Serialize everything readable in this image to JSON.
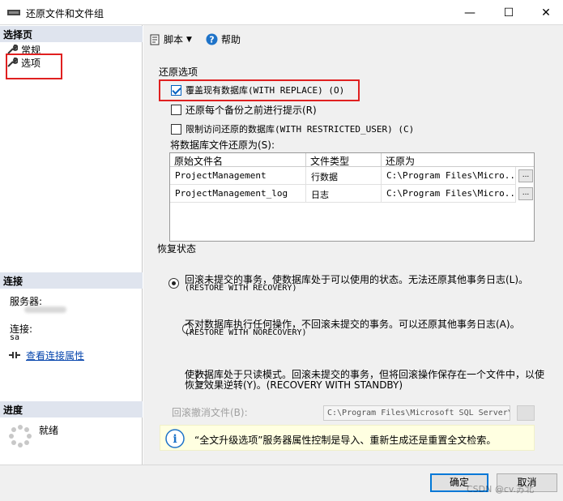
{
  "window": {
    "title": "还原文件和文件组",
    "minimize": "—",
    "maximize": "☐",
    "close": "✕"
  },
  "left": {
    "select_page_header": "选择页",
    "nav_items": [
      "常规",
      "选项"
    ],
    "connection_header": "连接",
    "server_label": "服务器:",
    "connection_label": "连接:",
    "connection_user": "sa",
    "view_conn_props": "查看连接属性",
    "progress_header": "进度",
    "progress_status": "就绪"
  },
  "toolbar": {
    "script_label": "脚本",
    "help_label": "帮助"
  },
  "restore_options": {
    "group_label": "还原选项",
    "overwrite": "覆盖现有数据库(WITH REPLACE) (O)",
    "overwrite_checked": true,
    "prompt_each": "还原每个备份之前进行提示(R)",
    "restrict": "限制访问还原的数据库(WITH RESTRICTED_USER) (C)",
    "restore_files_as": "将数据库文件还原为(S):"
  },
  "file_grid": {
    "columns": [
      "原始文件名",
      "文件类型",
      "还原为"
    ],
    "rows": [
      [
        "ProjectManagement",
        "行数据",
        "C:\\Program Files\\Micro..."
      ],
      [
        "ProjectManagement_log",
        "日志",
        "C:\\Program Files\\Micro..."
      ]
    ],
    "ellipsis": "..."
  },
  "recovery": {
    "group_label": "恢复状态",
    "opt1_line1": "回滚未提交的事务，使数据库处于可以使用的状态。无法还原其他事务日志(L)。",
    "opt1_line2": "(RESTORE WITH RECOVERY)",
    "opt2_line1": "不对数据库执行任何操作，不回滚未提交的事务。可以还原其他事务日志(A)。",
    "opt2_line2": "(RESTORE WITH NORECOVERY)",
    "opt3_line1": "使数据库处于只读模式。回滚未提交的事务，但将回滚操作保存在一个文件中，以使",
    "opt3_line2": "恢复效果逆转(Y)。(RECOVERY WITH STANDBY)",
    "standby_label": "回滚撤消文件(B):",
    "standby_path": "C:\\Program Files\\Microsoft SQL Server\\"
  },
  "info": {
    "text": "“全文升级选项”服务器属性控制是导入、重新生成还是重置全文检索。"
  },
  "buttons": {
    "ok": "确定",
    "cancel": "取消"
  },
  "watermark": "CSDN @cv.苏北"
}
